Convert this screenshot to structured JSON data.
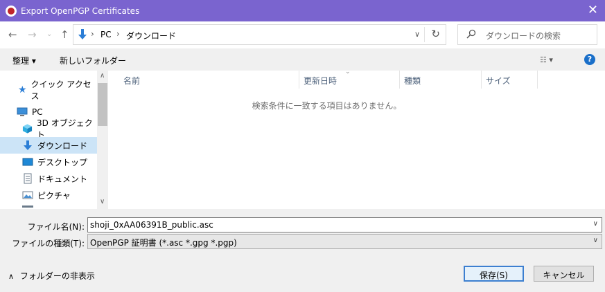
{
  "window": {
    "title": "Export OpenPGP Certificates",
    "close_icon": "close-icon"
  },
  "nav": {
    "back_icon": "arrow-left-icon",
    "forward_icon": "arrow-right-icon",
    "recent_icon": "chevron-down-icon",
    "up_icon": "arrow-up-icon"
  },
  "address": {
    "crumbs": [
      "PC",
      "ダウンロード"
    ],
    "refresh_icon": "refresh-icon"
  },
  "search": {
    "placeholder": "ダウンロードの検索"
  },
  "toolbar": {
    "organize": "整理 ▾",
    "new_folder": "新しいフォルダー",
    "help": "?"
  },
  "sidebar": {
    "items": [
      {
        "label": "クイック アクセス",
        "icon": "star-icon"
      },
      {
        "label": "PC",
        "icon": "computer-icon"
      },
      {
        "label": "3D オブジェクト",
        "icon": "cube-icon"
      },
      {
        "label": "ダウンロード",
        "icon": "download-icon",
        "selected": true
      },
      {
        "label": "デスクトップ",
        "icon": "desktop-icon"
      },
      {
        "label": "ドキュメント",
        "icon": "document-icon"
      },
      {
        "label": "ピクチャ",
        "icon": "picture-icon"
      }
    ]
  },
  "columns": [
    "名前",
    "更新日時",
    "種類",
    "サイズ"
  ],
  "empty_message": "検索条件に一致する項目はありません。",
  "filename": {
    "label": "ファイル名(N):",
    "value": "shoji_0xAA06391B_public.asc"
  },
  "filetype": {
    "label": "ファイルの種類(T):",
    "value": "OpenPGP 証明書 (*.asc *.gpg *.pgp)"
  },
  "hide_folders": "フォルダーの非表示",
  "buttons": {
    "save": "保存(S)",
    "cancel": "キャンセル"
  },
  "colors": {
    "titlebar": "#7a64cf",
    "selected": "#cce4f7",
    "accent": "#1a6fc9"
  }
}
